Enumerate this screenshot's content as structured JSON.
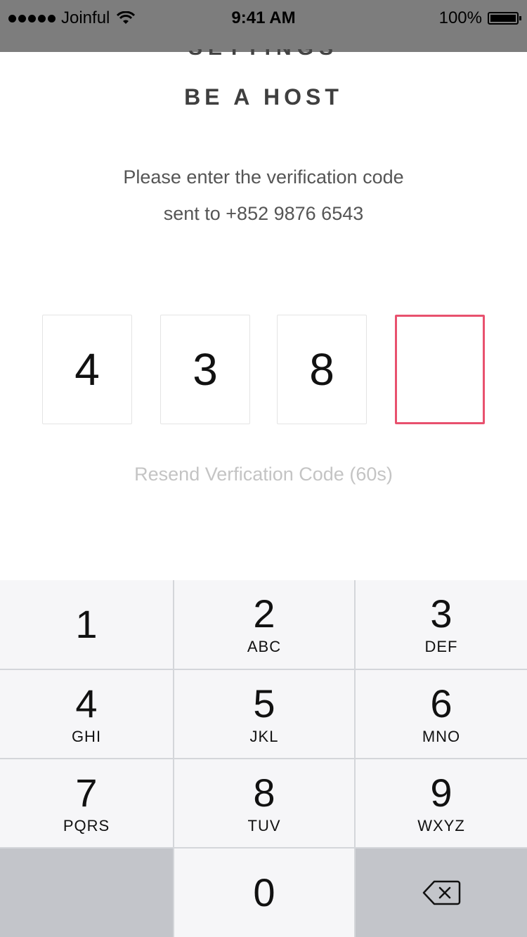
{
  "status_bar": {
    "carrier": "Joinful",
    "time": "9:41 AM",
    "battery": "100%"
  },
  "header": {
    "peek_text": "SETTINGS",
    "title": "BE A HOST"
  },
  "instructions": {
    "line1": "Please enter the verification code",
    "line2": "sent to +852 9876 6543"
  },
  "code": {
    "digits": [
      "4",
      "3",
      "8",
      ""
    ],
    "active_index": 3,
    "accent_color": "#e8516e"
  },
  "resend": {
    "label": "Resend Verfication Code (60s)"
  },
  "keypad": {
    "keys": [
      {
        "num": "1",
        "letters": ""
      },
      {
        "num": "2",
        "letters": "ABC"
      },
      {
        "num": "3",
        "letters": "DEF"
      },
      {
        "num": "4",
        "letters": "GHI"
      },
      {
        "num": "5",
        "letters": "JKL"
      },
      {
        "num": "6",
        "letters": "MNO"
      },
      {
        "num": "7",
        "letters": "PQRS"
      },
      {
        "num": "8",
        "letters": "TUV"
      },
      {
        "num": "9",
        "letters": "WXYZ"
      },
      {
        "num": "0",
        "letters": ""
      }
    ],
    "delete_icon": "backspace-icon"
  }
}
